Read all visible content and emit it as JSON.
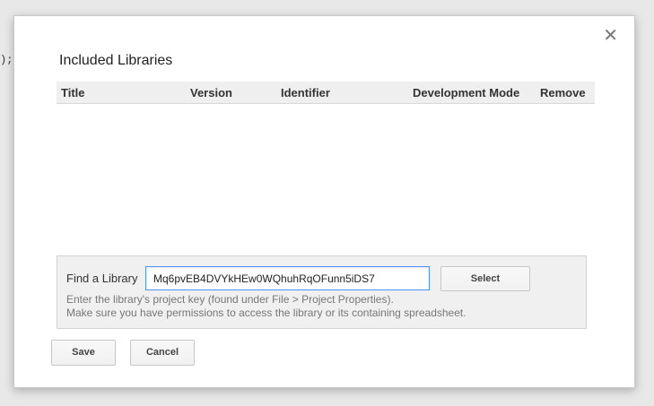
{
  "background": {
    "code_fragment": ");"
  },
  "dialog": {
    "close_glyph": "✕",
    "title": "Included Libraries",
    "table": {
      "columns": [
        "Title",
        "Version",
        "Identifier",
        "Development Mode",
        "Remove"
      ],
      "rows": []
    },
    "find": {
      "label": "Find a Library",
      "value": "Mq6pvEB4DVYkHEw0WQhuhRqOFunn5iDS7",
      "select_label": "Select",
      "help_line1": "Enter the library's project key (found under File > Project Properties).",
      "help_line2": "Make sure you have permissions to access the library or its containing spreadsheet."
    },
    "save_label": "Save",
    "cancel_label": "Cancel"
  },
  "colors": {
    "accent_focus": "#4d90fe",
    "header_bg": "#efefef",
    "panel_bg": "#f0f0f0"
  }
}
